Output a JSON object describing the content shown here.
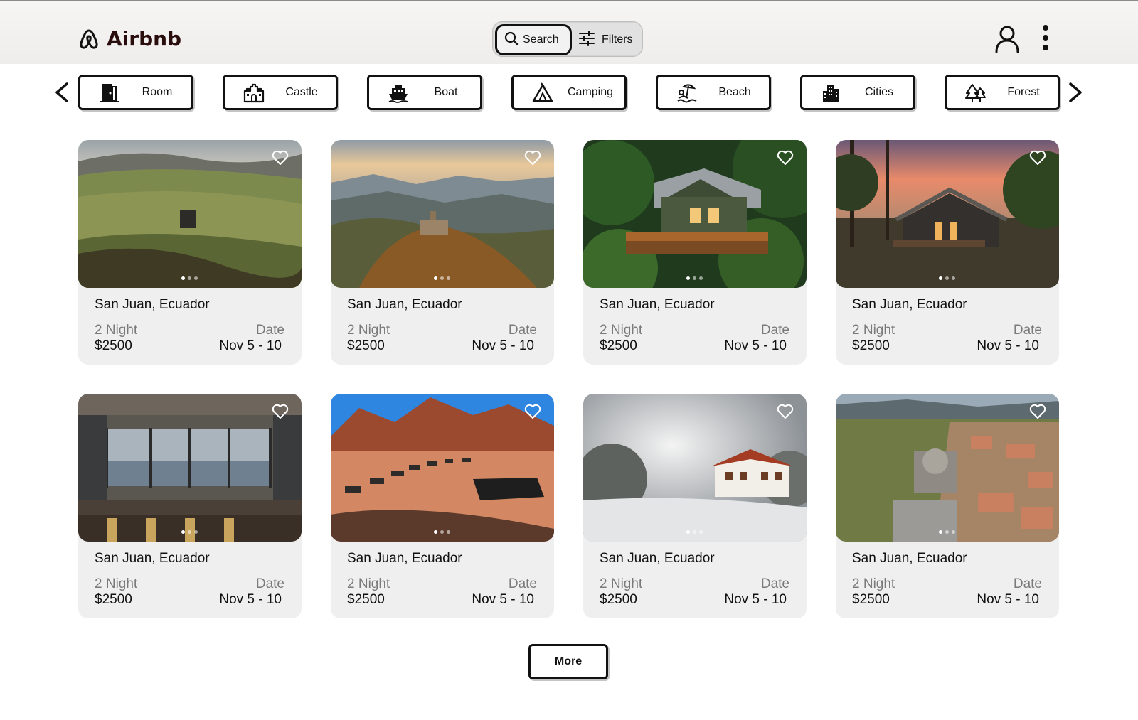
{
  "app": {
    "name": "Airbnb"
  },
  "header": {
    "search_label": "Search",
    "filters_label": "Filters",
    "user_icon": "user-icon",
    "menu_icon": "more-vertical-icon"
  },
  "categories": [
    {
      "label": "Room",
      "icon": "door-icon"
    },
    {
      "label": "Castle",
      "icon": "castle-icon"
    },
    {
      "label": "Boat",
      "icon": "boat-icon"
    },
    {
      "label": "Camping",
      "icon": "tent-icon"
    },
    {
      "label": "Beach",
      "icon": "beach-icon"
    },
    {
      "label": "Cities",
      "icon": "city-icon"
    },
    {
      "label": "Forest",
      "icon": "forest-icon"
    }
  ],
  "listings": [
    {
      "location": "San Juan, Ecuador",
      "nights": "2 Night",
      "price": "$2500",
      "date_label": "Date",
      "dates": "Nov 5 - 10"
    },
    {
      "location": "San Juan, Ecuador",
      "nights": "2 Night",
      "price": "$2500",
      "date_label": "Date",
      "dates": "Nov 5 - 10"
    },
    {
      "location": "San Juan, Ecuador",
      "nights": "2 Night",
      "price": "$2500",
      "date_label": "Date",
      "dates": "Nov 5 - 10"
    },
    {
      "location": "San Juan, Ecuador",
      "nights": "2 Night",
      "price": "$2500",
      "date_label": "Date",
      "dates": "Nov 5 - 10"
    },
    {
      "location": "San Juan, Ecuador",
      "nights": "2 Night",
      "price": "$2500",
      "date_label": "Date",
      "dates": "Nov 5 - 10"
    },
    {
      "location": "San Juan, Ecuador",
      "nights": "2 Night",
      "price": "$2500",
      "date_label": "Date",
      "dates": "Nov 5 - 10"
    },
    {
      "location": "San Juan, Ecuador",
      "nights": "2 Night",
      "price": "$2500",
      "date_label": "Date",
      "dates": "Nov 5 - 10"
    },
    {
      "location": "San Juan, Ecuador",
      "nights": "2 Night",
      "price": "$2500",
      "date_label": "Date",
      "dates": "Nov 5 - 10"
    }
  ],
  "more_label": "More",
  "colors": {
    "logo_text": "#2a0d0d",
    "card_bg": "#efefef",
    "muted_text": "#7a7a7a"
  }
}
